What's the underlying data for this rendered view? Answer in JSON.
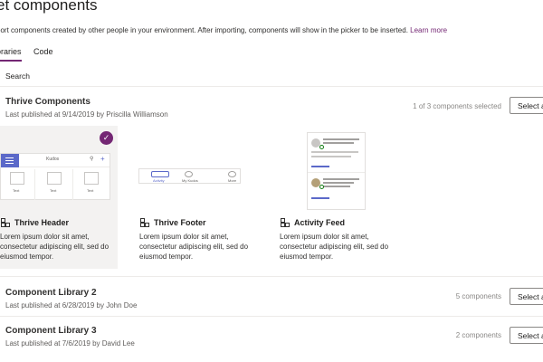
{
  "header": {
    "title": "et components",
    "description": "port components created by other people in your environment. After importing, components will show in the picker to be inserted.",
    "learn_more": "Learn more"
  },
  "tabs": [
    {
      "label": "oraries",
      "selected": true
    },
    {
      "label": "Code",
      "selected": false
    }
  ],
  "search": {
    "label": "Search"
  },
  "libraries": [
    {
      "name": "Thrive Components",
      "meta": "Last published at 9/14/2019 by Priscilla Williamson",
      "count": "1 of 3 components selected",
      "button": "Select a",
      "components": [
        {
          "name": "Thrive Header",
          "description": "Lorem ipsum dolor sit amet, consectetur adipiscing elit, sed do eiusmod tempor.",
          "selected": true
        },
        {
          "name": "Thrive Footer",
          "description": "Lorem ipsum dolor sit amet, consectetur adipiscing elit, sed do eiusmod tempor.",
          "selected": false
        },
        {
          "name": "Activity Feed",
          "description": "Lorem ipsum dolor sit amet, consectetur adipiscing elit, sed do eiusmod tempor.",
          "selected": false
        }
      ]
    },
    {
      "name": "Component Library 2",
      "meta": "Last published at 6/28/2019 by John Doe",
      "count": "5 components",
      "button": "Select a"
    },
    {
      "name": "Component Library 3",
      "meta": "Last published at 7/6/2019 by David Lee",
      "count": "2 components",
      "button": "Select a"
    }
  ],
  "previews": {
    "header_title": "Kudos",
    "header_tiles": [
      "Text",
      "Text",
      "Text"
    ],
    "footer_items": [
      "Activity",
      "My Kudos",
      "More"
    ]
  },
  "icons": {
    "check": "checkmark-icon",
    "component": "component-icon",
    "menu": "hamburger-icon",
    "search": "search-icon",
    "add": "plus-icon"
  },
  "colors": {
    "accent": "#742774",
    "preview_blue": "#5b69c9"
  }
}
